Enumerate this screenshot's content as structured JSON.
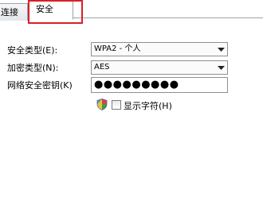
{
  "tabs": {
    "connect_label": "连接",
    "security_label": "安全"
  },
  "security_type": {
    "label": "安全类型(E):",
    "value": "WPA2 - 个人"
  },
  "encryption_type": {
    "label": "加密类型(N):",
    "value": "AES"
  },
  "network_key": {
    "label": "网络安全密钥(K)",
    "value": "●●●●●●●●●"
  },
  "show_characters": {
    "label": "显示字符(H)",
    "checked": false
  },
  "colors": {
    "highlight": "#d8202a"
  }
}
